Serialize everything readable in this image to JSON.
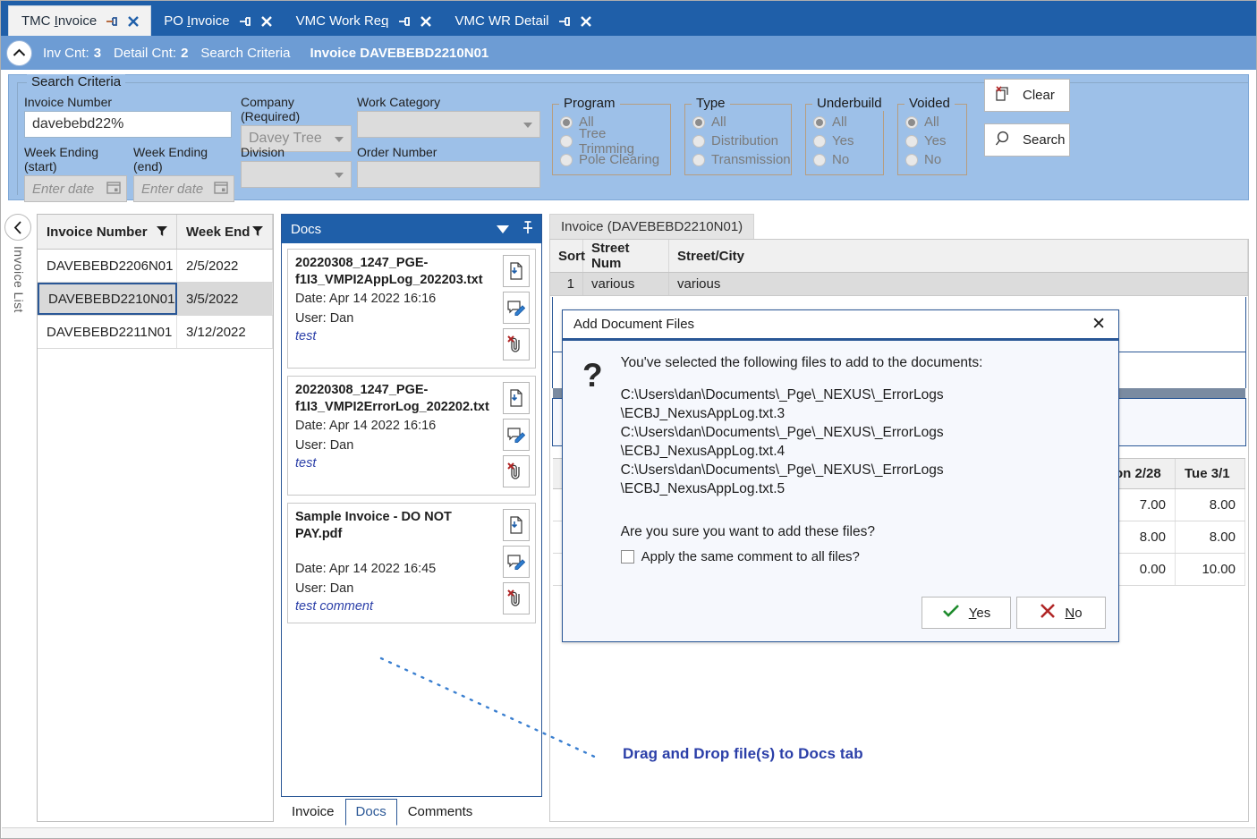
{
  "tabs": [
    {
      "label": "TMC Invoice",
      "accel": "I",
      "active": true
    },
    {
      "label": "PO Invoice",
      "accel": "I",
      "active": false
    },
    {
      "label": "VMC Work Req",
      "accel": "R",
      "active": false
    },
    {
      "label": "VMC WR Detail",
      "accel": "",
      "active": false
    }
  ],
  "infobar": {
    "inv_cnt_label": "Inv Cnt:",
    "inv_cnt_value": "3",
    "detail_cnt_label": "Detail Cnt:",
    "detail_cnt_value": "2",
    "search_criteria_label": "Search Criteria",
    "invoice_label": "Invoice DAVEBEBD2210N01"
  },
  "search": {
    "legend": "Search Criteria",
    "invoice_number_label": "Invoice Number",
    "invoice_number_value": "davebebd22%",
    "company_label": "Company (Required)",
    "company_value": "Davey Tree",
    "work_category_label": "Work Category",
    "work_category_value": "",
    "week_start_label": "Week Ending (start)",
    "week_start_placeholder": "Enter date",
    "week_end_label": "Week Ending (end)",
    "week_end_placeholder": "Enter date",
    "division_label": "Division",
    "division_value": "",
    "order_number_label": "Order Number",
    "order_number_value": "",
    "groups": [
      {
        "title": "Program",
        "options": [
          "All",
          "Tree Trimming",
          "Pole Clearing"
        ],
        "selected": "All"
      },
      {
        "title": "Type",
        "options": [
          "All",
          "Distribution",
          "Transmission"
        ],
        "selected": "All"
      },
      {
        "title": "Underbuild",
        "options": [
          "All",
          "Yes",
          "No"
        ],
        "selected": "All"
      },
      {
        "title": "Voided",
        "options": [
          "All",
          "Yes",
          "No"
        ],
        "selected": "All"
      }
    ],
    "clear_label": "Clear",
    "search_label": "Search"
  },
  "invoice_list": {
    "side_label": "Invoice List",
    "columns": [
      "Invoice Number",
      "Week End"
    ],
    "rows": [
      {
        "invoice": "DAVEBEBD2206N01",
        "week_end": "2/5/2022",
        "selected": false
      },
      {
        "invoice": "DAVEBEBD2210N01",
        "week_end": "3/5/2022",
        "selected": true
      },
      {
        "invoice": "DAVEBEBD2211N01",
        "week_end": "3/12/2022",
        "selected": false
      }
    ]
  },
  "docs": {
    "title": "Docs",
    "cards": [
      {
        "name": "20220308_1247_PGE-f1I3_VMPI2AppLog_202203.txt",
        "date_label": "Date:",
        "date": "Apr 14 2022 16:16",
        "user_label": "User:",
        "user": "Dan",
        "comment": "test"
      },
      {
        "name": "20220308_1247_PGE-f1I3_VMPI2ErrorLog_202202.txt",
        "date_label": "Date:",
        "date": "Apr 14 2022 16:16",
        "user_label": "User:",
        "user": "Dan",
        "comment": "test"
      },
      {
        "name": "Sample Invoice - DO NOT PAY.pdf",
        "date_label": "Date:",
        "date": "Apr 14 2022 16:45",
        "user_label": "User:",
        "user": "Dan",
        "comment": "test comment"
      }
    ]
  },
  "bottom_tabs": [
    {
      "label": "Invoice",
      "active": false
    },
    {
      "label": "Docs",
      "active": true
    },
    {
      "label": "Comments",
      "active": false
    }
  ],
  "detail": {
    "tab_label": "Invoice (DAVEBEBD2210N01)",
    "columns": [
      "Sort",
      "Street Num",
      "Street/City"
    ],
    "row": {
      "sort": "1",
      "street_num": "various",
      "street_city": "various"
    },
    "day_columns": [
      "on 2/28",
      "Tue 3/1"
    ],
    "day_rows": [
      [
        "7.00",
        "8.00"
      ],
      [
        "8.00",
        "8.00"
      ],
      [
        "0.00",
        "10.00"
      ]
    ]
  },
  "drag_hint": "Drag and Drop file(s) to Docs tab",
  "dialog": {
    "title": "Add Document Files",
    "intro": "You've selected the following files to add to the documents:",
    "paths": [
      "C:\\Users\\dan\\Documents\\_Pge\\_NEXUS\\_ErrorLogs",
      "\\ECBJ_NexusAppLog.txt.3",
      "C:\\Users\\dan\\Documents\\_Pge\\_NEXUS\\_ErrorLogs",
      "\\ECBJ_NexusAppLog.txt.4",
      "C:\\Users\\dan\\Documents\\_Pge\\_NEXUS\\_ErrorLogs",
      "\\ECBJ_NexusAppLog.txt.5"
    ],
    "question": "Are you sure you want to add these files?",
    "checkbox_label": "Apply the same comment to all files?",
    "checkbox_checked": false,
    "yes_label": "Yes",
    "no_label": "No",
    "close_glyph": "✕"
  },
  "colors": {
    "tabstrip_blue": "#1f5fa9",
    "infobar_blue": "#6d9cd4",
    "panel_blue": "#9dc0e8",
    "accent_navy": "#2a5796",
    "comment_blue": "#2b3fa8"
  }
}
